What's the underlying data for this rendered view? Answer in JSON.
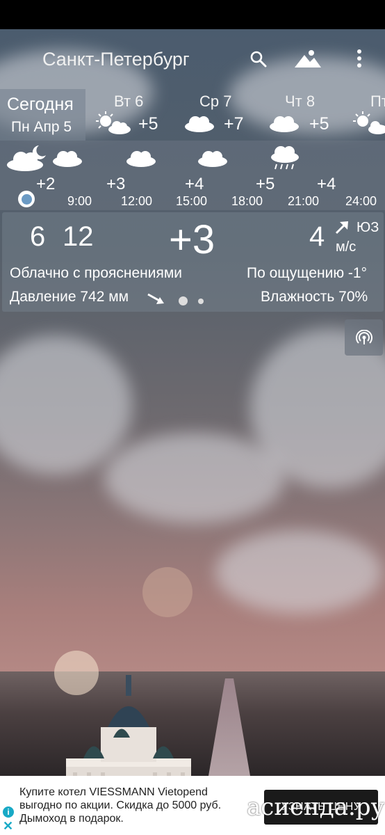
{
  "app": {
    "city": "Санкт-Петербург"
  },
  "toolbar": {
    "search_icon": "search-icon",
    "background_icon": "mountain-icon",
    "menu_icon": "more-vertical-icon"
  },
  "days": {
    "today_label": "Сегодня",
    "today_date": "Пн Апр 5",
    "items": [
      {
        "name": "Вт 6",
        "temp": "+5",
        "icon": "partly-sunny-icon"
      },
      {
        "name": "Ср 7",
        "temp": "+7",
        "icon": "cloud-icon"
      },
      {
        "name": "Чт 8",
        "temp": "+5",
        "icon": "cloud-icon"
      },
      {
        "name": "Пт",
        "temp": "",
        "icon": "partly-sunny-icon"
      }
    ]
  },
  "hourly": {
    "temps": [
      "+2",
      "+3",
      "+4",
      "+5",
      "+4"
    ],
    "times": [
      "9:00",
      "12:00",
      "15:00",
      "18:00",
      "21:00",
      "24:00"
    ]
  },
  "current": {
    "min": "6",
    "max": "12",
    "temp": "+3",
    "wind_speed": "4",
    "wind_unit": "м/с",
    "wind_dir": "ЮЗ",
    "condition": "Облачно с прояснениями",
    "feels_like": "По ощущению -1°",
    "pressure": "Давление 742 мм",
    "humidity": "Влажность 70%"
  },
  "ad": {
    "text": "Купите котел VIESSMANN Vietopend выгодно по акции. Скидка до 5000 руб. Дымоход в подарок.",
    "button": "УЗНАТЬ ЦЕНУ",
    "watermark": "асиенда.ру"
  }
}
